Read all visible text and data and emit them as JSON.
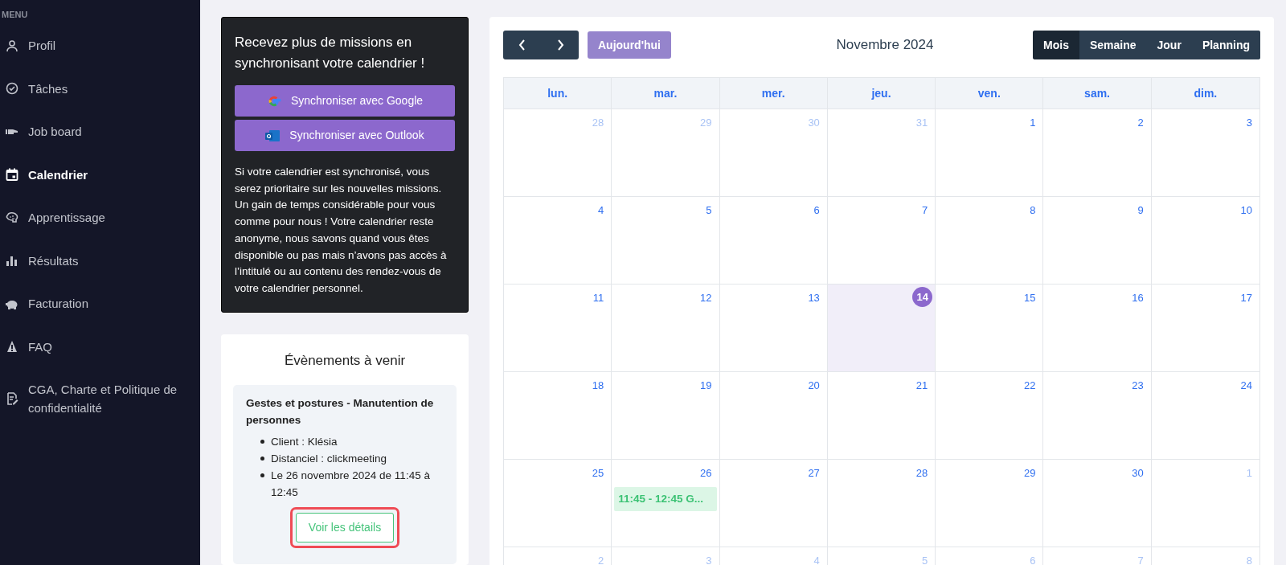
{
  "sidebar": {
    "heading": "MENU",
    "items": [
      {
        "label": "Profil",
        "selected": false
      },
      {
        "label": "Tâches",
        "selected": false
      },
      {
        "label": "Job board",
        "selected": false
      },
      {
        "label": "Calendrier",
        "selected": true
      },
      {
        "label": "Apprentissage",
        "selected": false
      },
      {
        "label": "Résultats",
        "selected": false
      },
      {
        "label": "Facturation",
        "selected": false
      },
      {
        "label": "FAQ",
        "selected": false
      },
      {
        "label": "CGA, Charte et Politique de confidentialité",
        "selected": false
      }
    ]
  },
  "sync_card": {
    "title": "Recevez plus de missions en synchronisant votre calendrier !",
    "buttons": [
      {
        "kind": "google",
        "label": "Synchroniser avec Google"
      },
      {
        "kind": "outlook",
        "label": "Synchroniser avec Outlook"
      }
    ],
    "text": "Si votre calendrier est synchronisé, vous serez prioritaire sur les nouvelles missions. Un gain de temps considérable pour vous comme pour nous ! Votre calendrier reste anonyme, nous savons quand vous êtes disponible ou pas mais n’avons pas accès à l’intitulé ou au contenu des rendez-vous de votre calendrier personnel."
  },
  "upcoming": {
    "title": "Évènements à venir",
    "events": [
      {
        "title": "Gestes et postures - Manutention de personnes",
        "details": [
          "Client : Klésia",
          "Distanciel : clickmeeting",
          "Le 26 novembre 2024 de 11:45 à 12:45"
        ],
        "button": "Voir les détails",
        "highlighted": true
      }
    ]
  },
  "calendar": {
    "today_button": "Aujourd'hui",
    "title": "Novembre 2024",
    "views": [
      {
        "label": "Mois",
        "selected": true
      },
      {
        "label": "Semaine",
        "selected": false
      },
      {
        "label": "Jour",
        "selected": false
      },
      {
        "label": "Planning",
        "selected": false
      }
    ],
    "weekdays": [
      "lun.",
      "mar.",
      "mer.",
      "jeu.",
      "ven.",
      "sam.",
      "dim."
    ],
    "weeks": [
      [
        {
          "day": "28",
          "outside": true
        },
        {
          "day": "29",
          "outside": true
        },
        {
          "day": "30",
          "outside": true
        },
        {
          "day": "31",
          "outside": true
        },
        {
          "day": "1",
          "outside": false
        },
        {
          "day": "2",
          "outside": false
        },
        {
          "day": "3",
          "outside": false
        }
      ],
      [
        {
          "day": "4",
          "outside": false
        },
        {
          "day": "5",
          "outside": false
        },
        {
          "day": "6",
          "outside": false
        },
        {
          "day": "7",
          "outside": false
        },
        {
          "day": "8",
          "outside": false
        },
        {
          "day": "9",
          "outside": false
        },
        {
          "day": "10",
          "outside": false
        }
      ],
      [
        {
          "day": "11",
          "outside": false
        },
        {
          "day": "12",
          "outside": false
        },
        {
          "day": "13",
          "outside": false
        },
        {
          "day": "14",
          "outside": false,
          "today": true
        },
        {
          "day": "15",
          "outside": false
        },
        {
          "day": "16",
          "outside": false
        },
        {
          "day": "17",
          "outside": false
        }
      ],
      [
        {
          "day": "18",
          "outside": false
        },
        {
          "day": "19",
          "outside": false
        },
        {
          "day": "20",
          "outside": false
        },
        {
          "day": "21",
          "outside": false
        },
        {
          "day": "22",
          "outside": false
        },
        {
          "day": "23",
          "outside": false
        },
        {
          "day": "24",
          "outside": false
        }
      ],
      [
        {
          "day": "25",
          "outside": false
        },
        {
          "day": "26",
          "outside": false,
          "events": [
            "11:45 - 12:45 G..."
          ]
        },
        {
          "day": "27",
          "outside": false
        },
        {
          "day": "28",
          "outside": false
        },
        {
          "day": "29",
          "outside": false
        },
        {
          "day": "30",
          "outside": false
        },
        {
          "day": "1",
          "outside": true
        }
      ],
      [
        {
          "day": "2",
          "outside": true
        },
        {
          "day": "3",
          "outside": true
        },
        {
          "day": "4",
          "outside": true
        },
        {
          "day": "5",
          "outside": true
        },
        {
          "day": "6",
          "outside": true
        },
        {
          "day": "7",
          "outside": true
        },
        {
          "day": "8",
          "outside": true
        }
      ]
    ]
  }
}
